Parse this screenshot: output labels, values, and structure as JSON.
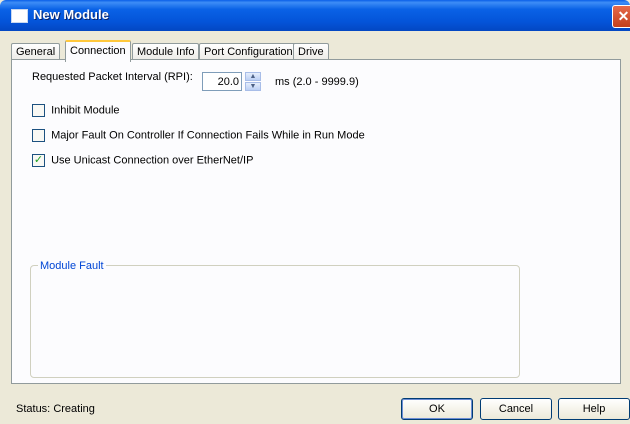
{
  "window": {
    "title": "New Module",
    "close_glyph": "✕"
  },
  "tabs": [
    {
      "label": "General"
    },
    {
      "label": "Connection"
    },
    {
      "label": "Module Info"
    },
    {
      "label": "Port Configuration"
    },
    {
      "label": "Drive"
    }
  ],
  "active_tab": "Connection",
  "connection": {
    "rpi_label": "Requested Packet Interval (RPI):",
    "rpi_value": "20.0",
    "rpi_range": "ms (2.0 - 9999.9)",
    "spinner_up": "▲",
    "spinner_down": "▼",
    "checkboxes": [
      {
        "label": "Inhibit Module",
        "checked": false
      },
      {
        "label": "Major Fault On Controller If Connection Fails While in Run Mode",
        "checked": false
      },
      {
        "label": "Use Unicast Connection over EtherNet/IP",
        "checked": true
      }
    ],
    "check_glyph": "✓",
    "module_fault_title": "Module Fault"
  },
  "footer": {
    "status_label": "Status:",
    "status_value": "Creating",
    "ok_label": "OK",
    "cancel_label": "Cancel",
    "help_label": "Help"
  },
  "colors": {
    "titlebar": "#0454d9",
    "dialog_bg": "#ece9d8",
    "active_tab_accent": "#ffc83c",
    "groupbox_title": "#0046d5",
    "check_mark": "#21a121"
  },
  "icons": {
    "title_icon": "window-icon",
    "close": "close-icon"
  }
}
